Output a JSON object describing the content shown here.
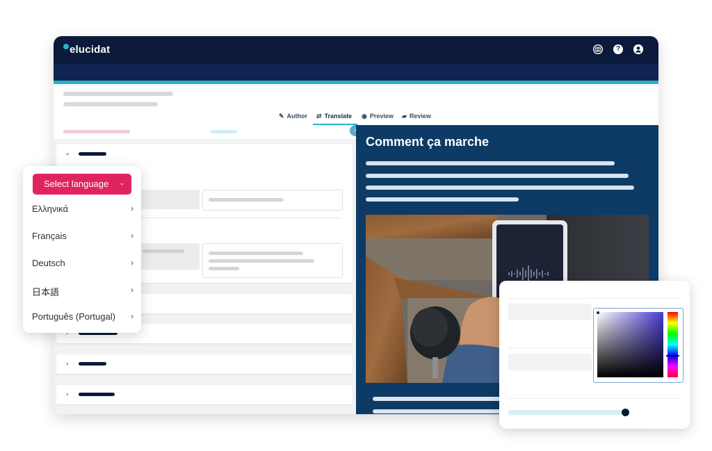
{
  "app": {
    "logo_text": "elucidat"
  },
  "topbar_icons": [
    "globe-icon",
    "help-icon",
    "account-icon"
  ],
  "modes": [
    {
      "label": "Author",
      "icon": "pencil-icon"
    },
    {
      "label": "Translate",
      "icon": "swap-icon",
      "active": true
    },
    {
      "label": "Preview",
      "icon": "eye-icon"
    },
    {
      "label": "Review",
      "icon": "comment-icon"
    }
  ],
  "preview": {
    "heading": "Comment ça marche"
  },
  "language_menu": {
    "button_label": "Select language",
    "items": [
      "Ελληνικά",
      "Français",
      "Deutsch",
      "日本語",
      "Português (Portugal)"
    ]
  },
  "color_picker": {
    "hue_color": "#4a3bd4",
    "slider_value": 0.97
  },
  "colors": {
    "topbar": "#0b1a3a",
    "accent": "#27b3c9",
    "brand_pink": "#e0245e",
    "preview_bg": "#0d3b66"
  }
}
